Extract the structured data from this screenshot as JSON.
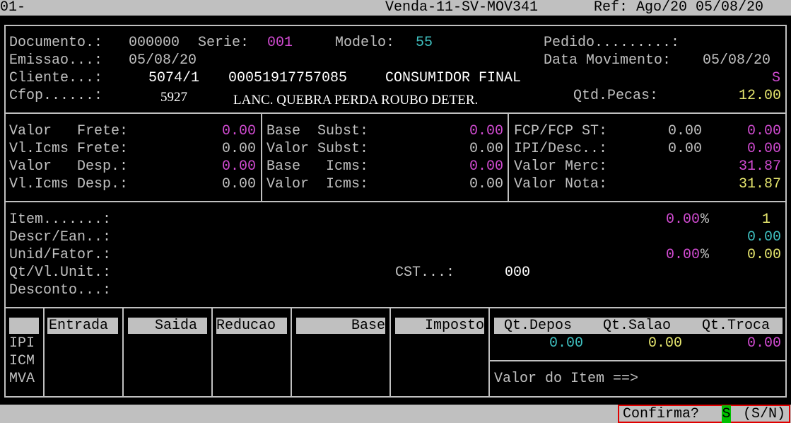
{
  "topbar": {
    "left": "01-",
    "title": "Venda-11-SV-MOV341",
    "ref": "Ref: Ago/20 05/08/20"
  },
  "header": {
    "documento_label": "Documento.:",
    "documento_value": "000000",
    "serie_label": "Serie:",
    "serie_value": "001",
    "modelo_label": "Modelo:",
    "modelo_value": "55",
    "pedido_label": "Pedido.........:",
    "emissao_label": "Emissao...:",
    "emissao_value": "05/08/20",
    "data_mov_label": "Data Movimento:",
    "data_mov_value": "05/08/20",
    "cliente_label": "Cliente...:",
    "cliente_code": "5074/1",
    "cliente_doc": "00051917757085",
    "cliente_name": "CONSUMIDOR FINAL",
    "cliente_flag": "S",
    "cfop_label": "Cfop......:",
    "cfop_value": "5927",
    "cfop_desc": "LANC. QUEBRA PERDA ROUBO DETER.",
    "qtd_pecas_label": "Qtd.Pecas:",
    "qtd_pecas_value": "12.00"
  },
  "totals": {
    "col1": [
      {
        "label": "Valor   Frete:",
        "value": "0.00"
      },
      {
        "label": "Vl.Icms Frete:",
        "value": "0.00"
      },
      {
        "label": "Valor   Desp.:",
        "value": "0.00"
      },
      {
        "label": "Vl.Icms Desp.:",
        "value": "0.00"
      }
    ],
    "col2": [
      {
        "label": "Base  Subst:",
        "value": "0.00"
      },
      {
        "label": "Valor Subst:",
        "value": "0.00"
      },
      {
        "label": "Base   Icms:",
        "value": "0.00"
      },
      {
        "label": "Valor  Icms:",
        "value": "0.00"
      }
    ],
    "col3": [
      {
        "label": "FCP/FCP ST:",
        "v1": "0.00",
        "v2": "0.00"
      },
      {
        "label": "IPI/Desc..:",
        "v1": "0.00",
        "v2": "0.00"
      },
      {
        "label": "Valor Merc:",
        "v2": "31.87"
      },
      {
        "label": "Valor Nota:",
        "v2": "31.87"
      }
    ]
  },
  "item": {
    "item_label": "Item.......:",
    "item_pct": "0.00",
    "item_pct_sign": "%",
    "item_num": "1",
    "descr_label": "Descr/Ean..:",
    "descr_value": "0.00",
    "unid_label": "Unid/Fator.:",
    "unid_pct": "0.00",
    "unid_pct_sign": "%",
    "unid_value": "0.00",
    "qt_label": "Qt/Vl.Unit.:",
    "cst_label": "CST...:",
    "cst_value": "000",
    "desconto_label": "Desconto...:"
  },
  "tax": {
    "headers": [
      "Entrada",
      "Saida",
      "Reducao",
      "Base",
      "Imposto"
    ],
    "rows": [
      "IPI",
      "ICM",
      "MVA"
    ],
    "stock_headers": [
      "Qt.Depos",
      "Qt.Salao",
      "Qt.Troca"
    ],
    "stock_values": [
      "0.00",
      "0.00",
      "0.00"
    ],
    "valor_item_label": "Valor do Item ==>"
  },
  "footer": {
    "confirm_label": "Confirma?",
    "confirm_value": "S",
    "confirm_options": "(S/N)"
  },
  "colors": {
    "magenta": "#d14bd1",
    "cyan": "#3fc0c0",
    "yellow": "#e6e66e",
    "gray": "#c0c0c0",
    "confirm_border": "#e00000",
    "confirm_green": "#00c000"
  }
}
